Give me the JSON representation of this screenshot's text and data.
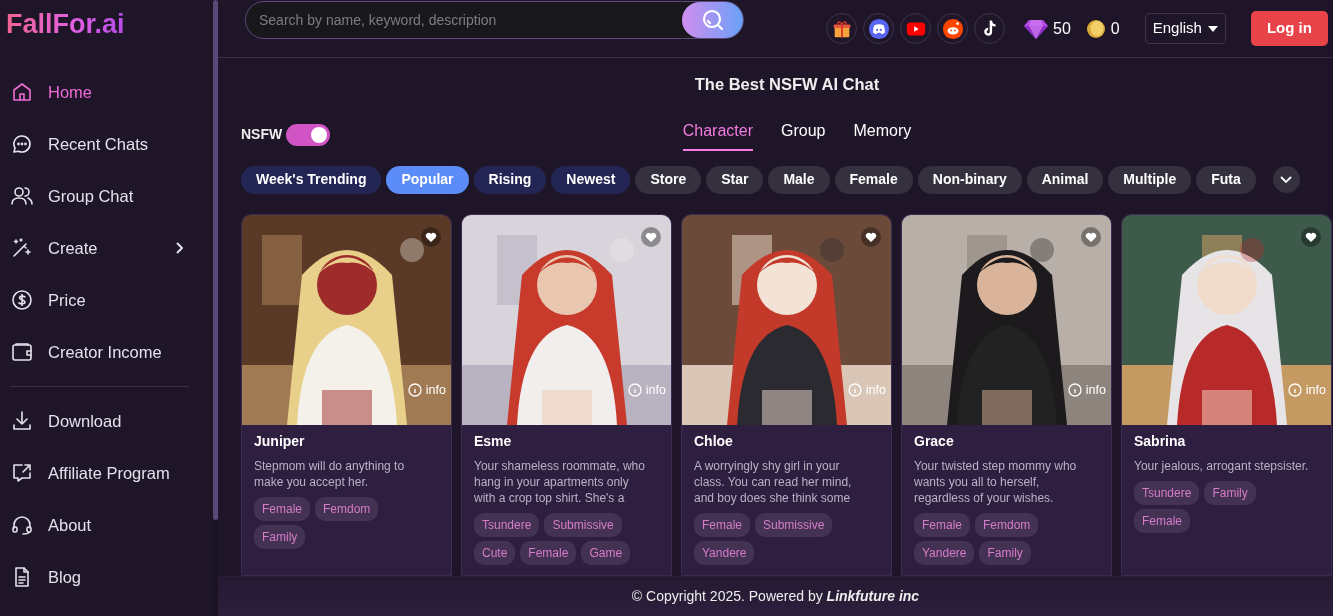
{
  "logo": "FallFor.ai",
  "sidebar": {
    "sections": [
      {
        "items": [
          {
            "label": "Home",
            "kind": "home",
            "selected": true,
            "submenu": false
          },
          {
            "label": "Recent Chats",
            "kind": "chat",
            "selected": false,
            "submenu": false
          },
          {
            "label": "Group Chat",
            "kind": "people",
            "selected": false,
            "submenu": false
          },
          {
            "label": "Create",
            "kind": "wand",
            "selected": false,
            "submenu": true
          },
          {
            "label": "Price",
            "kind": "dollar",
            "selected": false,
            "submenu": false
          },
          {
            "label": "Creator Income",
            "kind": "wallet",
            "selected": false,
            "submenu": false
          }
        ]
      },
      {
        "items": [
          {
            "label": "Download",
            "kind": "download",
            "selected": false,
            "submenu": false
          },
          {
            "label": "Affiliate Program",
            "kind": "share",
            "selected": false,
            "submenu": false
          },
          {
            "label": "About",
            "kind": "headset",
            "selected": false,
            "submenu": false
          },
          {
            "label": "Blog",
            "kind": "document",
            "selected": false,
            "submenu": false
          }
        ]
      }
    ]
  },
  "search": {
    "placeholder": "Search by name, keyword, description"
  },
  "social_links": [
    {
      "kind": "gift"
    },
    {
      "kind": "discord"
    },
    {
      "kind": "youtube"
    },
    {
      "kind": "reddit"
    },
    {
      "kind": "tiktok"
    }
  ],
  "balance": {
    "gems": "50",
    "coins": "0"
  },
  "language": "English",
  "login_button": "Log in",
  "heading": "The Best NSFW AI Chat",
  "nsfw_toggle": {
    "label": "NSFW",
    "on": true
  },
  "tabs": [
    {
      "label": "Character",
      "selected": true
    },
    {
      "label": "Group",
      "selected": false
    },
    {
      "label": "Memory",
      "selected": false
    }
  ],
  "filters": [
    {
      "label": "Week's Trending",
      "kind": "sort",
      "selected": false
    },
    {
      "label": "Popular",
      "kind": "sort",
      "selected": true
    },
    {
      "label": "Rising",
      "kind": "sort",
      "selected": false
    },
    {
      "label": "Newest",
      "kind": "sort",
      "selected": false
    },
    {
      "label": "Store",
      "kind": "category",
      "selected": false
    },
    {
      "label": "Star",
      "kind": "category",
      "selected": false
    },
    {
      "label": "Male",
      "kind": "category",
      "selected": false
    },
    {
      "label": "Female",
      "kind": "category",
      "selected": false
    },
    {
      "label": "Non-binary",
      "kind": "category",
      "selected": false
    },
    {
      "label": "Animal",
      "kind": "category",
      "selected": false
    },
    {
      "label": "Multiple",
      "kind": "category",
      "selected": false
    },
    {
      "label": "Futa",
      "kind": "category",
      "selected": false
    }
  ],
  "cards": [
    {
      "kind": "picture",
      "info_label": "info",
      "name": "Juniper",
      "description": "Stepmom will do anything to make you accept her.",
      "tags": [
        "Female",
        "Femdom",
        "Family"
      ]
    },
    {
      "kind": "picture",
      "info_label": "info",
      "name": "Esme",
      "description": "Your shameless roommate, who hang in your apartments only with a crop top shirt. She's a",
      "tags": [
        "Tsundere",
        "Submissive",
        "Cute",
        "Female",
        "Game"
      ]
    },
    {
      "kind": "picture",
      "info_label": "info",
      "name": "Chloe",
      "description": "A worryingly shy girl in your class. You can read her mind, and boy does she think some",
      "tags": [
        "Female",
        "Submissive",
        "Yandere"
      ]
    },
    {
      "kind": "picture",
      "info_label": "info",
      "name": "Grace",
      "description": "Your twisted step mommy who wants you all to herself, regardless of your wishes.",
      "tags": [
        "Female",
        "Femdom",
        "Yandere",
        "Family"
      ]
    },
    {
      "kind": "picture",
      "info_label": "info",
      "name": "Sabrina",
      "description": "Your jealous, arrogant stepsister.",
      "tags": [
        "Tsundere",
        "Family",
        "Female"
      ]
    }
  ],
  "footer": "© Copyright 2025. Powered by **Linkfuture inc**"
}
